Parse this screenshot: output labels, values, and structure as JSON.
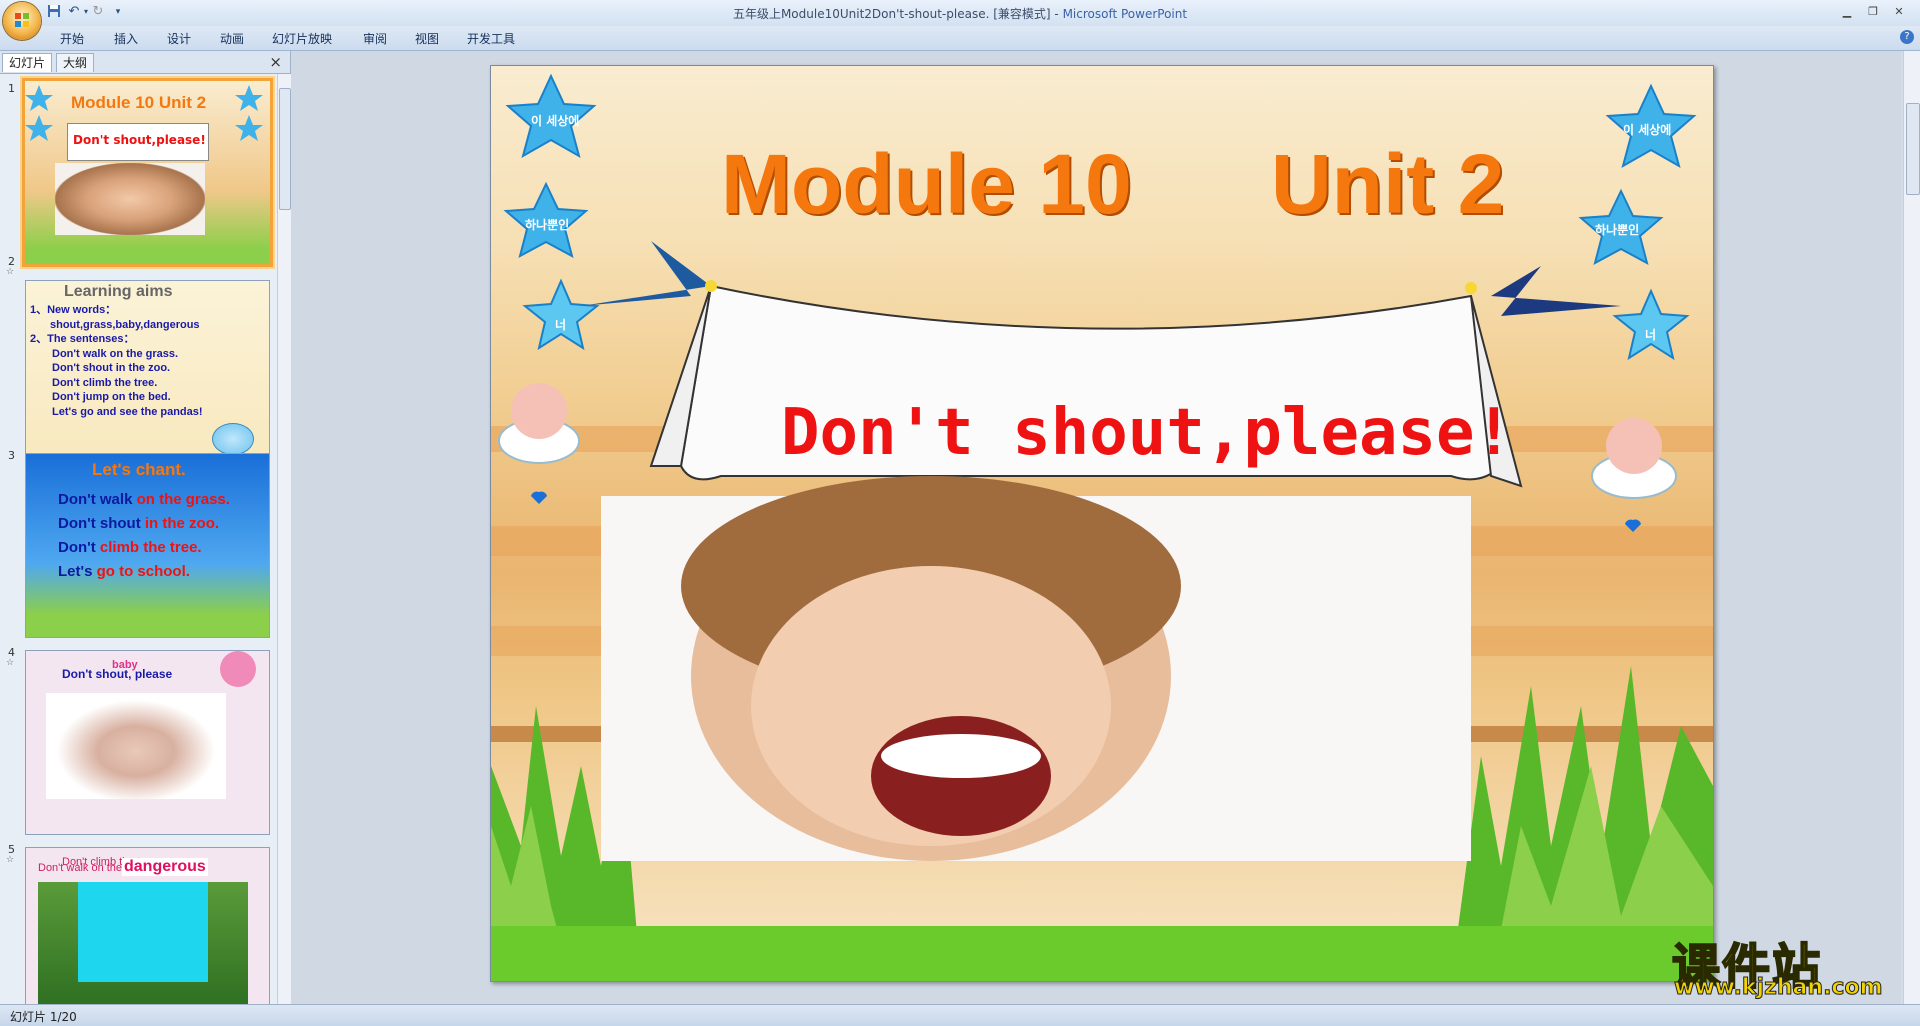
{
  "window": {
    "title": "五年级上Module10Unit2Don't-shout-please. [兼容模式]",
    "separator": " - ",
    "app_name": "Microsoft PowerPoint"
  },
  "ribbon": {
    "tabs": [
      "开始",
      "插入",
      "设计",
      "动画",
      "幻灯片放映",
      "审阅",
      "视图",
      "开发工具"
    ]
  },
  "left_pane": {
    "tabs": [
      "幻灯片",
      "大纲"
    ],
    "close": "×",
    "slides": [
      {
        "num": "1",
        "title": "Module 10    Unit 2",
        "banner": "Don't shout,please!"
      },
      {
        "num": "2",
        "heading": "Learning aims",
        "lines": [
          "1、New words：",
          "shout,grass,baby,dangerous",
          "2、The sentenses：",
          "Don't walk on the grass.",
          "Don't shout in the zoo.",
          "Don't climb the tree.",
          "Don't jump on the bed.",
          "Let's go and see the pandas!"
        ]
      },
      {
        "num": "3",
        "heading": "Let's  chant.",
        "lines": [
          {
            "a": "Don't walk ",
            "b": "on the grass."
          },
          {
            "a": "Don't shout ",
            "b": "in the zoo."
          },
          {
            "a": "Don't ",
            "b": "climb the tree."
          },
          {
            "a": "Let's ",
            "b": "go to school."
          }
        ]
      },
      {
        "num": "4",
        "label": "Don't shout, please",
        "overlay": "baby"
      },
      {
        "num": "5",
        "overlay1": "Don't climb the tree",
        "overlay2": "Don't walk on the",
        "word": "dangerous"
      }
    ]
  },
  "slide": {
    "title_module": "Module 10",
    "title_unit": "Unit 2",
    "banner_text": "Don't shout,please!",
    "star_texts": [
      "이 세상에",
      "하나뿐인",
      "너"
    ]
  },
  "status": {
    "text": "幻灯片 1/20"
  },
  "watermark": {
    "cn": "课件站",
    "url": "www.kjzhan.com"
  },
  "colors": {
    "title_orange": "#f5780f",
    "banner_red": "#ee1212",
    "highlight": "#f2a33a"
  }
}
